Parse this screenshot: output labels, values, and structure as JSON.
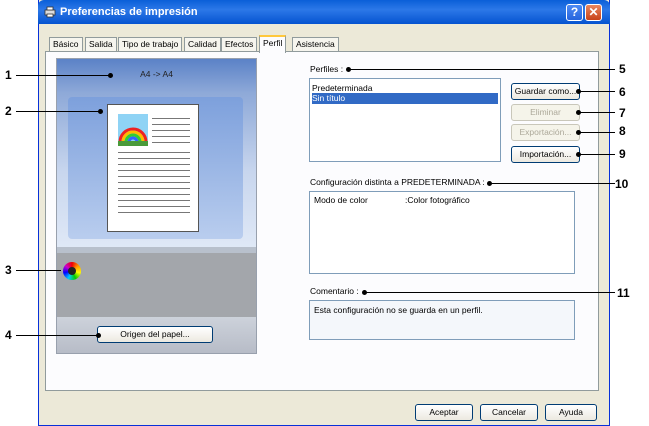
{
  "window": {
    "title": "Preferencias de impresión",
    "help": "?",
    "close": "✕"
  },
  "tabs": [
    {
      "label": "Básico"
    },
    {
      "label": "Salida"
    },
    {
      "label": "Tipo de trabajo"
    },
    {
      "label": "Calidad"
    },
    {
      "label": "Efectos"
    },
    {
      "label": "Perfil"
    },
    {
      "label": "Asistencia"
    }
  ],
  "active_tab": "Perfil",
  "preview": {
    "label": "A4 -> A4",
    "paper_source_button": "Origen del papel..."
  },
  "profiles": {
    "label": "Perfiles :",
    "items": [
      {
        "label": "Predeterminada"
      },
      {
        "label": "Sin título"
      }
    ],
    "selected": "Sin título",
    "save_as": "Guardar como...",
    "delete": "Eliminar",
    "export": "Exportación...",
    "import": "Importación..."
  },
  "differences": {
    "label": "Configuración distinta a PREDETERMINADA :",
    "rows": [
      {
        "name": "Modo de color",
        "value": ":Color fotográfico"
      }
    ]
  },
  "comment": {
    "label": "Comentario :",
    "text": "Esta configuración no se guarda en un perfil."
  },
  "footer": {
    "ok": "Aceptar",
    "cancel": "Cancelar",
    "help": "Ayuda"
  },
  "callouts": [
    "1",
    "2",
    "3",
    "4",
    "5",
    "6",
    "7",
    "8",
    "9",
    "10",
    "11"
  ]
}
